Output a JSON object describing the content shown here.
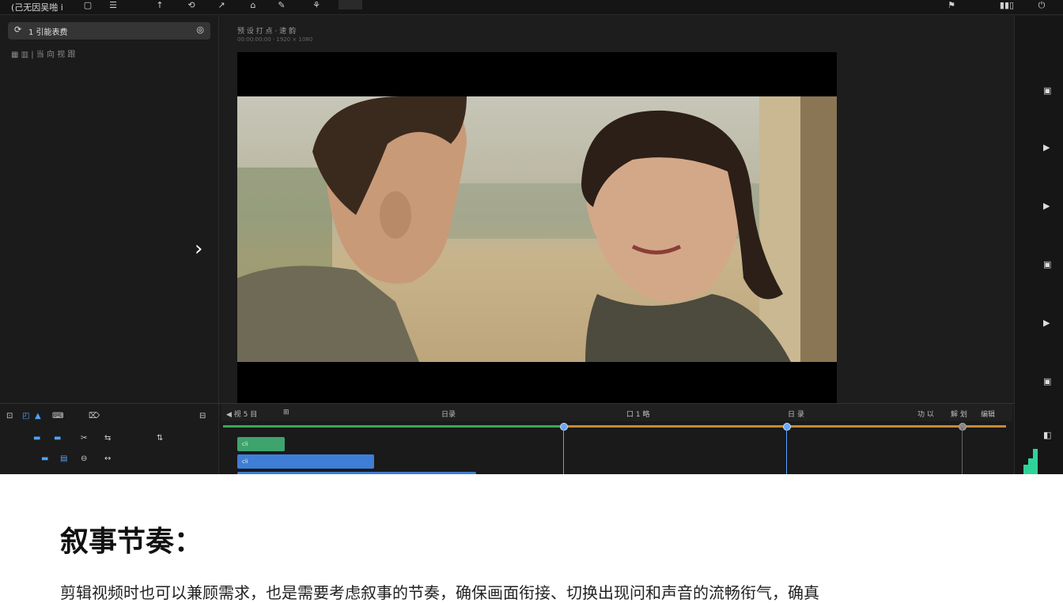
{
  "menubar": {
    "title": "(己无因吴啪 i",
    "tools": [
      "▢",
      "☰",
      "↑",
      "⟲",
      "↗",
      "⌂",
      "✎",
      "⚘"
    ],
    "right_tools": [
      "⚑",
      "▮▮▯",
      "⏻"
    ]
  },
  "left_panel": {
    "search_label": "1  引能表费",
    "search_lead_icon": "⟳",
    "search_trail_icon": "◎",
    "subrow": "▦  ▥  |  当 向 视 跟",
    "chevron": "›"
  },
  "preview": {
    "label": "预 设 打 点 · 速 韵",
    "sublabel": "00:00:00:00 · 1920 × 1080"
  },
  "timeline": {
    "tools": [
      "⊡",
      "◰",
      "▲",
      "⌨",
      "⌦",
      "⊟"
    ],
    "row1_tools": [
      "▬",
      "▬",
      "✂",
      "⇆",
      "⇅"
    ],
    "row2_tools": [
      "▬",
      "▤",
      "⊖",
      "↔"
    ],
    "ruler_labels": [
      "◀ 视 5 目",
      "⊞",
      "日录",
      "口 1 略",
      "日 录",
      "功 以",
      "解 划",
      "编辑"
    ],
    "clips": [
      {
        "label": "cli",
        "color": "#3fa36e"
      },
      {
        "label": "cli",
        "color": "#3e7ed6"
      },
      {
        "label": "",
        "color": "#3e7ed6"
      }
    ]
  },
  "right_panel": {
    "icons": [
      "▣",
      "▶",
      "▶",
      "▣",
      "▶",
      "▣",
      "◧"
    ]
  },
  "caption": {
    "heading": "叙事节奏：",
    "body": "剪辑视频时也可以兼顾需求，也是需要考虑叙事的节奏，确保画面衔接、切换出现问和声音的流畅衔气，确真"
  }
}
